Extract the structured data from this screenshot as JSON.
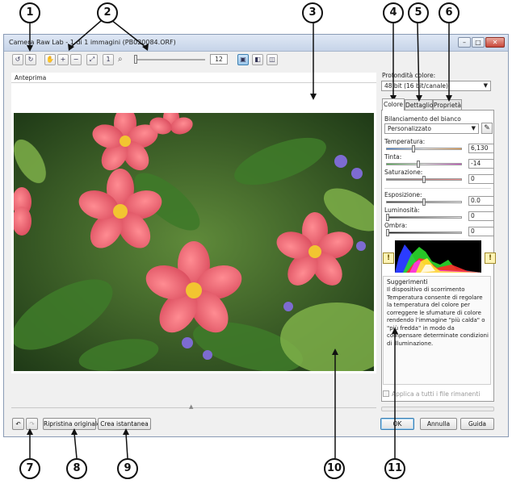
{
  "callouts": [
    "1",
    "2",
    "3",
    "4",
    "5",
    "6",
    "7",
    "8",
    "9",
    "10",
    "11"
  ],
  "window": {
    "title": "Camera Raw Lab - 1 di 1 immagini (PB020084.ORF)",
    "controls": {
      "minimize": "–",
      "maximize": "□",
      "close": "✕"
    }
  },
  "toolbar": {
    "zoom_value": "12",
    "icons": [
      "rotate-left-icon",
      "rotate-right-icon",
      "hand-tool-icon",
      "zoom-in-icon",
      "zoom-out-icon",
      "fit-window-icon",
      "actual-size-icon",
      "zoom-icon",
      "single-view-icon",
      "split-view-icon",
      "compare-view-icon"
    ]
  },
  "preview": {
    "label": "Anteprima"
  },
  "right_panel": {
    "color_depth_label": "Profondità colore:",
    "color_depth_value": "48 bit (16 bit/canale)",
    "tabs": [
      "Colore",
      "Dettaglio",
      "Proprietà"
    ],
    "white_balance_label": "Bilanciamento del bianco",
    "white_balance_value": "Personalizzato",
    "temperature_label": "Temperatura:",
    "temperature_value": "6,130",
    "tint_label": "Tinta:",
    "tint_value": "-14",
    "saturation_label": "Saturazione:",
    "saturation_value": "0",
    "exposure_label": "Esposizione:",
    "exposure_value": "0.0",
    "brightness_label": "Luminosità:",
    "brightness_value": "0",
    "shadows_label": "Ombra:",
    "shadows_value": "0",
    "hints_title": "Suggerimenti",
    "hints_text": "Il dispositivo di scorrimento Temperatura consente di regolare la temperatura del colore per correggere le sfumature di colore rendendo l'immagine \"più calda\" o \"più fredda\" in modo da compensare determinate condizioni di illuminazione.",
    "apply_all_label": "Applica a tutti i file rimanenti"
  },
  "bottom": {
    "reset_label": "Ripristina originale",
    "snapshot_label": "Crea istantanea",
    "ok_label": "OK",
    "cancel_label": "Annulla",
    "help_label": "Guida"
  },
  "colors": {
    "accent": "#3c7fb1",
    "title_bar": "#c6d4e8"
  }
}
